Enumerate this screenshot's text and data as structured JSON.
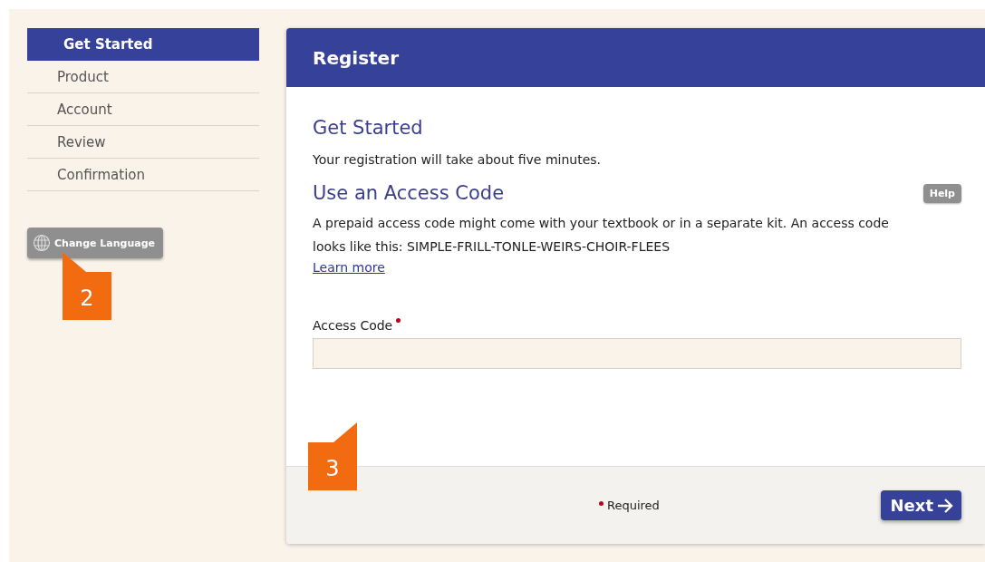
{
  "steps": [
    {
      "label": "Get Started",
      "selected": true
    },
    {
      "label": "Product",
      "selected": false
    },
    {
      "label": "Account",
      "selected": false
    },
    {
      "label": "Review",
      "selected": false
    },
    {
      "label": "Confirmation",
      "selected": false
    }
  ],
  "language_button": {
    "label": "Change Language"
  },
  "callouts": [
    {
      "number": "2"
    },
    {
      "number": "3"
    }
  ],
  "panel": {
    "title": "Register",
    "heading": "Get Started",
    "intro": "Your registration will take about five minutes.",
    "section_heading": "Use an Access Code",
    "help_button": "Help",
    "description": "A prepaid access code might come with your textbook or in a separate kit. An access code looks like this: SIMPLE-FRILL-TONLE-WEIRS-CHOIR-FLEES",
    "link": "Learn more",
    "field": {
      "label": "Access Code",
      "required": true
    },
    "footer": {
      "required_note": "Required",
      "next_button": "Next"
    }
  }
}
